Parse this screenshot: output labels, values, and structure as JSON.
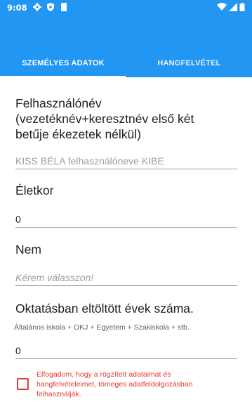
{
  "status_bar": {
    "time": "9:08",
    "left_icons": [
      "gear-icon",
      "shield-icon",
      "sdcard-icon"
    ],
    "right_icons": [
      "wifi-icon",
      "signal-icon",
      "battery-icon"
    ]
  },
  "tabs": [
    {
      "label": "SZEMÉLYES ADATOK",
      "active": true
    },
    {
      "label": "HANGFELVÉTEL",
      "active": false
    }
  ],
  "colors": {
    "primary": "#2196f3",
    "error": "#e53935"
  },
  "form": {
    "username": {
      "label_lines": [
        "Felhasználónév",
        "(vezetéknév+keresztnév első két",
        "betűje ékezetek nélkül)"
      ],
      "placeholder": "KISS BÉLA felhasználóneve KIBE"
    },
    "age": {
      "label": "Életkor",
      "value": "0"
    },
    "gender": {
      "label": "Nem",
      "placeholder": "Kérem válasszon!"
    },
    "education": {
      "label": "Oktatásban eltöltött évek száma.",
      "hint": "Általános iskola + OKJ + Egyetem + Szakiskola + stb.",
      "value": "0"
    },
    "consent": {
      "checked": false,
      "text_lines": [
        "Elfogadom, hogy a rögzített adataimat és",
        "hangfelvételeimet, tömeges adatfeldolgozásban",
        "felhasználják."
      ]
    }
  }
}
